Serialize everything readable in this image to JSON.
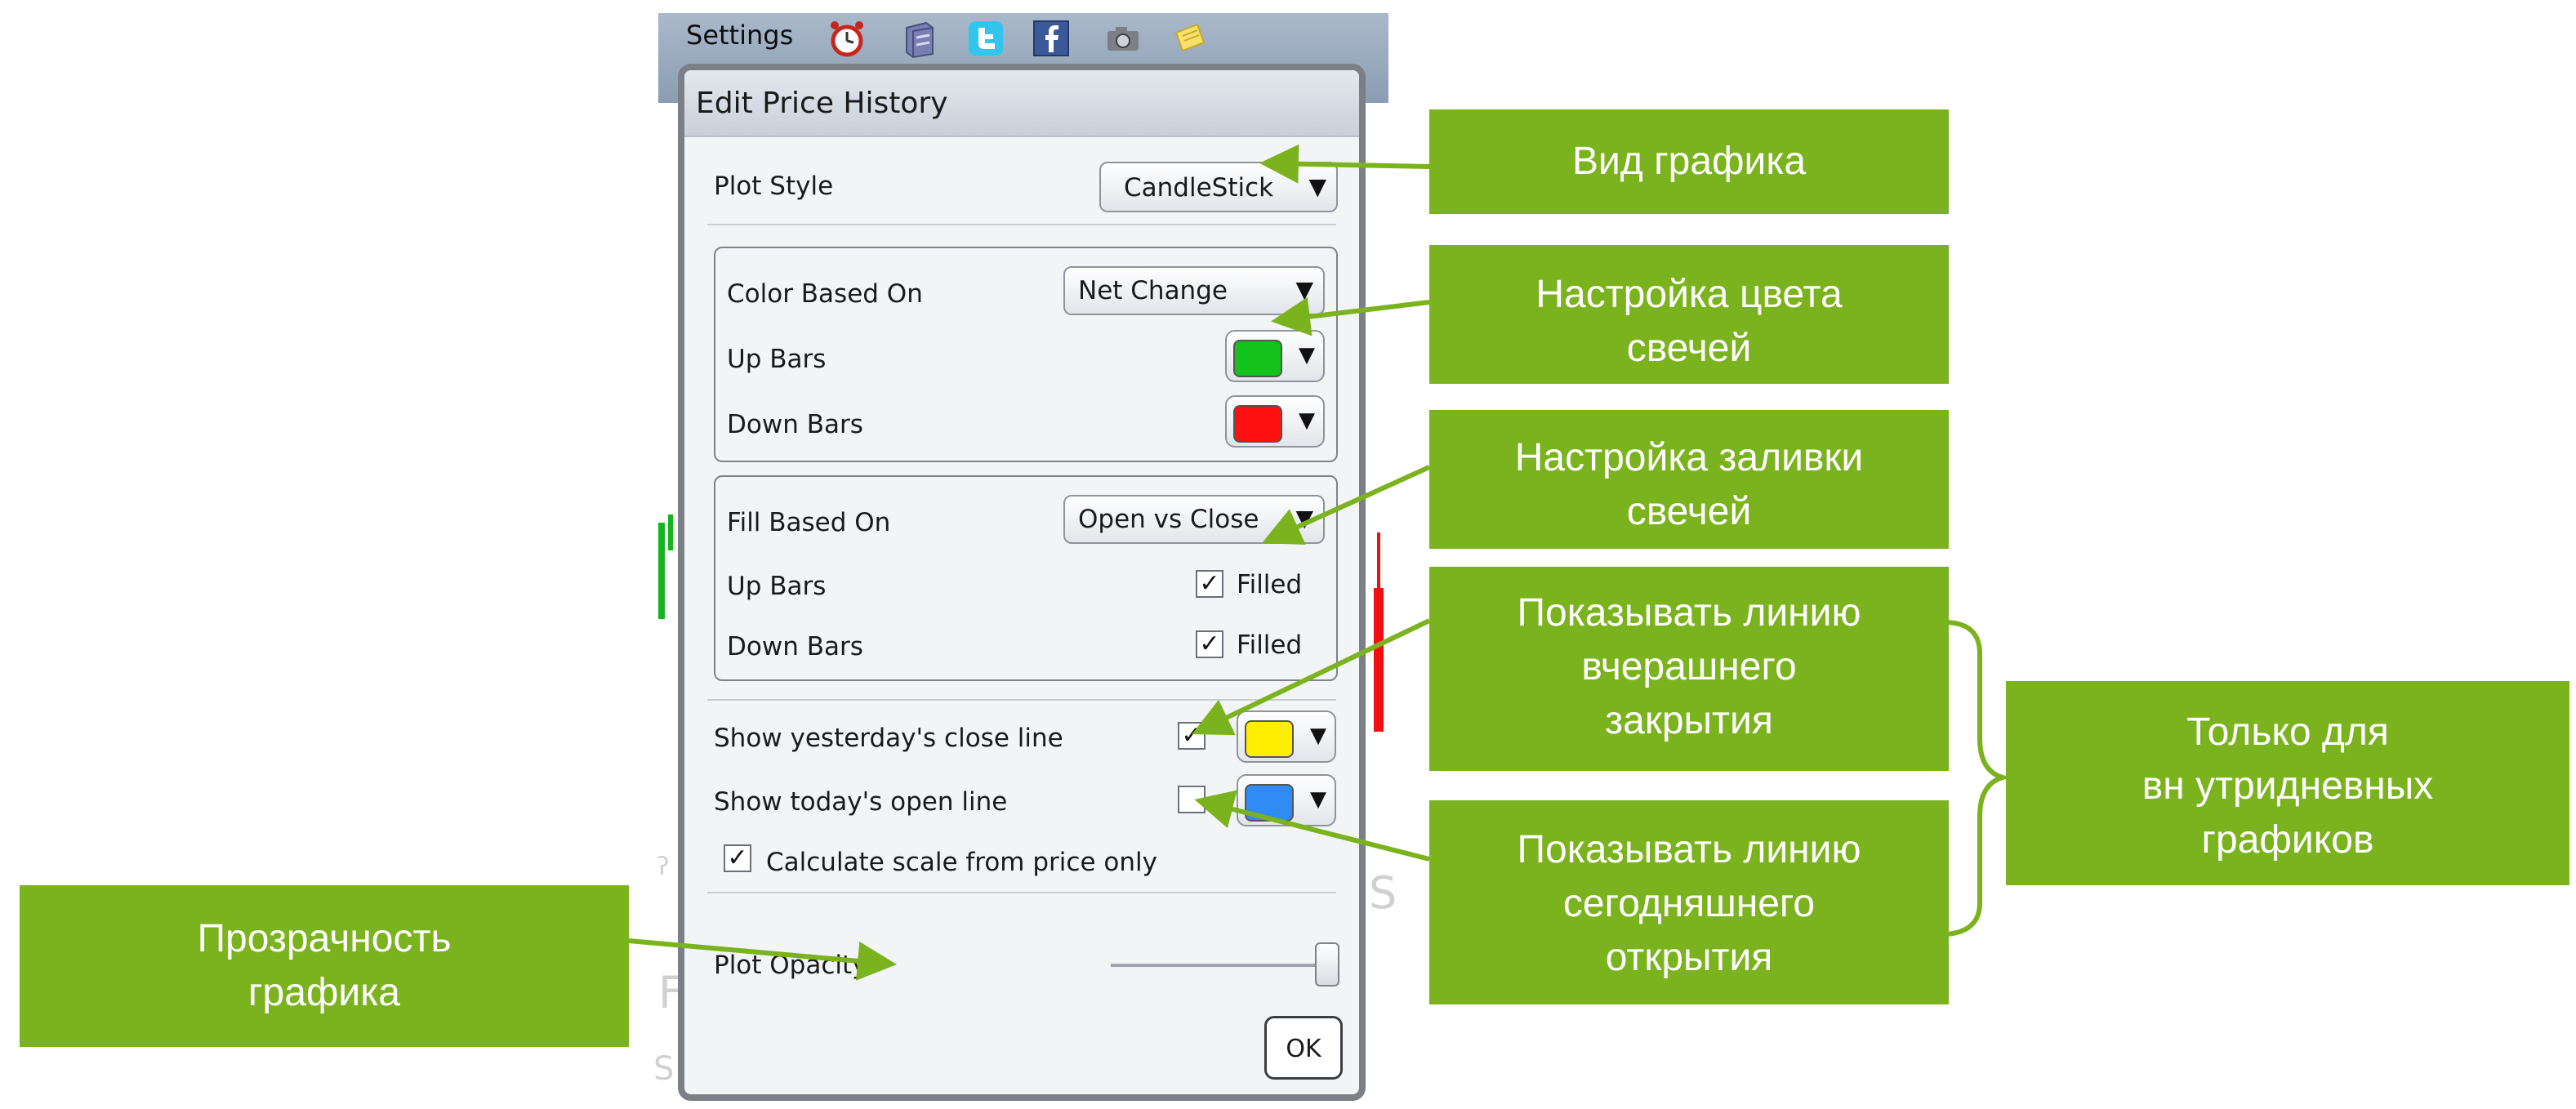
{
  "toolbar": {
    "settings_label": "Settings",
    "icons": [
      "alarm-clock-icon",
      "database-icon",
      "twitter-icon",
      "facebook-icon",
      "camera-icon",
      "note-icon"
    ]
  },
  "dialog": {
    "title": "Edit Price History",
    "plot_style": {
      "label": "Plot Style",
      "value": "CandleStick"
    },
    "color_group": {
      "color_based_on": {
        "label": "Color Based On",
        "value": "Net Change"
      },
      "up_bars": {
        "label": "Up Bars",
        "color": "#13c21b"
      },
      "down_bars": {
        "label": "Down Bars",
        "color": "#ff1010"
      }
    },
    "fill_group": {
      "fill_based_on": {
        "label": "Fill Based On",
        "value": "Open vs Close"
      },
      "up_bars": {
        "label": "Up Bars",
        "checkbox_label": "Filled",
        "checked": true
      },
      "down_bars": {
        "label": "Down Bars",
        "checkbox_label": "Filled",
        "checked": true
      }
    },
    "yesterday_close": {
      "label": "Show yesterday's close line",
      "checked": true,
      "color": "#ffee00"
    },
    "today_open": {
      "label": "Show today's open line",
      "checked": false,
      "color": "#2f8cf5"
    },
    "calc_scale": {
      "label": "Calculate scale from price only",
      "checked": true
    },
    "plot_opacity": {
      "label": "Plot Opacity",
      "value": 1.0
    },
    "ok_label": "OK"
  },
  "callouts": {
    "plot_type": [
      "Вид графика"
    ],
    "candle_color": [
      "Настройка цвета",
      "свечей"
    ],
    "candle_fill": [
      "Настройка заливки",
      "свечей"
    ],
    "yesterday_close": [
      "Показывать линию",
      "вчерашнего",
      "закрытия"
    ],
    "today_open": [
      "Показывать линию",
      "сегодняшнего",
      "открытия"
    ],
    "intraday_only": [
      "Только для",
      "вн  утридневных",
      "графиков"
    ],
    "transparency": [
      "Прозрачность",
      "графика"
    ]
  },
  "colors": {
    "callout_green": "#7bb31e",
    "dialog_border": "#7b7f86"
  }
}
